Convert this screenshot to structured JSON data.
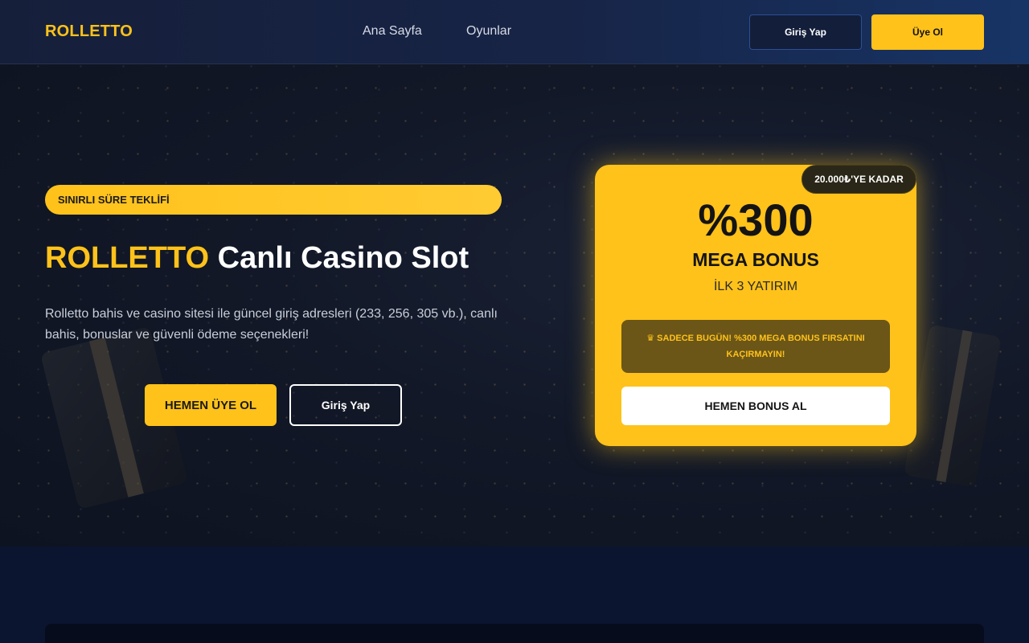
{
  "header": {
    "logo": "ROLLETTO",
    "nav": [
      "Ana Sayfa",
      "Oyunlar"
    ],
    "login_label": "Giriş Yap",
    "register_label": "Üye Ol"
  },
  "hero": {
    "badge": "SINIRLI SÜRE TEKLİFİ",
    "title_brand": "ROLLETTO",
    "title_rest": "Canlı Casino Slot",
    "description": "Rolletto bahis ve casino sitesi ile güncel giriş adresleri (233, 256, 305 vb.), canlı bahis, bonuslar ve güvenli ödeme seçenekleri!",
    "primary_button": "HEMEN ÜYE OL",
    "secondary_button": "Giriş Yap"
  },
  "bonus_card": {
    "tag": "20.000₺'YE KADAR",
    "percent": "%300",
    "title": "MEGA BONUS",
    "subtitle": "İLK 3 YATIRIM",
    "alert": "SADECE BUGÜN! %300 MEGA BONUS FIRSATINI KAÇIRMAYIN!",
    "alert_icon": "crown-icon",
    "cta": "HEMEN BONUS AL"
  },
  "colors": {
    "accent": "#ffc21a",
    "header_bg": "#161f3a",
    "hero_bg": "#121827",
    "lower_bg": "#0b1530"
  }
}
